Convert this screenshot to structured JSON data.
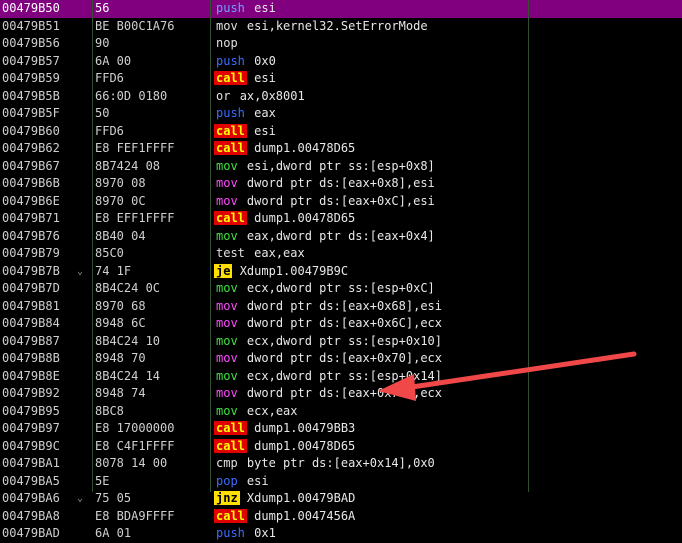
{
  "rows": [
    {
      "addr": "00479B50",
      "jmp": "",
      "hex": "56",
      "mn": "push",
      "ops": "esi",
      "cls": "m-push",
      "selected": true
    },
    {
      "addr": "00479B51",
      "jmp": "",
      "hex": "BE B00C1A76",
      "mn": "mov",
      "ops": "esi,kernel32.SetErrorMode",
      "cls": "m-nop"
    },
    {
      "addr": "00479B56",
      "jmp": "",
      "hex": "90",
      "mn": "nop",
      "ops": "",
      "cls": "m-nop"
    },
    {
      "addr": "00479B57",
      "jmp": "",
      "hex": "6A 00",
      "mn": "push",
      "ops": "0x0",
      "cls": "m-push"
    },
    {
      "addr": "00479B59",
      "jmp": "",
      "hex": "FFD6",
      "mn": "call",
      "ops": "esi",
      "cls": "m-call"
    },
    {
      "addr": "00479B5B",
      "jmp": "",
      "hex": "66:0D 0180",
      "mn": "or",
      "ops": "ax,0x8001",
      "cls": "m-or"
    },
    {
      "addr": "00479B5F",
      "jmp": "",
      "hex": "50",
      "mn": "push",
      "ops": "eax",
      "cls": "m-push"
    },
    {
      "addr": "00479B60",
      "jmp": "",
      "hex": "FFD6",
      "mn": "call",
      "ops": "esi",
      "cls": "m-call"
    },
    {
      "addr": "00479B62",
      "jmp": "",
      "hex": "E8 FEF1FFFF",
      "mn": "call",
      "ops": "dump1.00478D65",
      "cls": "m-call"
    },
    {
      "addr": "00479B67",
      "jmp": "",
      "hex": "8B7424 08",
      "mn": "mov",
      "ops": "esi,dword ptr ss:[esp+0x8]",
      "cls": "m-movreg"
    },
    {
      "addr": "00479B6B",
      "jmp": "",
      "hex": "8970 08",
      "mn": "mov",
      "ops": "dword ptr ds:[eax+0x8],esi",
      "cls": "m-mov"
    },
    {
      "addr": "00479B6E",
      "jmp": "",
      "hex": "8970 0C",
      "mn": "mov",
      "ops": "dword ptr ds:[eax+0xC],esi",
      "cls": "m-mov"
    },
    {
      "addr": "00479B71",
      "jmp": "",
      "hex": "E8 EFF1FFFF",
      "mn": "call",
      "ops": "dump1.00478D65",
      "cls": "m-call"
    },
    {
      "addr": "00479B76",
      "jmp": "",
      "hex": "8B40 04",
      "mn": "mov",
      "ops": "eax,dword ptr ds:[eax+0x4]",
      "cls": "m-movreg"
    },
    {
      "addr": "00479B79",
      "jmp": "",
      "hex": "85C0",
      "mn": "test",
      "ops": "eax,eax",
      "cls": "m-test"
    },
    {
      "addr": "00479B7B",
      "jmp": "⌄",
      "hex": "74 1F",
      "mn": "je",
      "ops": "Xdump1.00479B9C",
      "cls": "m-jcc"
    },
    {
      "addr": "00479B7D",
      "jmp": "",
      "hex": "8B4C24 0C",
      "mn": "mov",
      "ops": "ecx,dword ptr ss:[esp+0xC]",
      "cls": "m-movreg"
    },
    {
      "addr": "00479B81",
      "jmp": "",
      "hex": "8970 68",
      "mn": "mov",
      "ops": "dword ptr ds:[eax+0x68],esi",
      "cls": "m-mov"
    },
    {
      "addr": "00479B84",
      "jmp": "",
      "hex": "8948 6C",
      "mn": "mov",
      "ops": "dword ptr ds:[eax+0x6C],ecx",
      "cls": "m-mov"
    },
    {
      "addr": "00479B87",
      "jmp": "",
      "hex": "8B4C24 10",
      "mn": "mov",
      "ops": "ecx,dword ptr ss:[esp+0x10]",
      "cls": "m-movreg"
    },
    {
      "addr": "00479B8B",
      "jmp": "",
      "hex": "8948 70",
      "mn": "mov",
      "ops": "dword ptr ds:[eax+0x70],ecx",
      "cls": "m-mov"
    },
    {
      "addr": "00479B8E",
      "jmp": "",
      "hex": "8B4C24 14",
      "mn": "mov",
      "ops": "ecx,dword ptr ss:[esp+0x14]",
      "cls": "m-movreg"
    },
    {
      "addr": "00479B92",
      "jmp": "",
      "hex": "8948 74",
      "mn": "mov",
      "ops": "dword ptr ds:[eax+0x74],ecx",
      "cls": "m-mov"
    },
    {
      "addr": "00479B95",
      "jmp": "",
      "hex": "8BC8",
      "mn": "mov",
      "ops": "ecx,eax",
      "cls": "m-movreg"
    },
    {
      "addr": "00479B97",
      "jmp": "",
      "hex": "E8 17000000",
      "mn": "call",
      "ops": "dump1.00479BB3",
      "cls": "m-call"
    },
    {
      "addr": "00479B9C",
      "jmp": "",
      "hex": "E8 C4F1FFFF",
      "mn": "call",
      "ops": "dump1.00478D65",
      "cls": "m-call"
    },
    {
      "addr": "00479BA1",
      "jmp": "",
      "hex": "8078 14 00",
      "mn": "cmp",
      "ops": "byte ptr ds:[eax+0x14],0x0",
      "cls": "m-cmp"
    },
    {
      "addr": "00479BA5",
      "jmp": "",
      "hex": "5E",
      "mn": "pop",
      "ops": "esi",
      "cls": "m-pop"
    },
    {
      "addr": "00479BA6",
      "jmp": "⌄",
      "hex": "75 05",
      "mn": "jnz",
      "ops": "Xdump1.00479BAD",
      "cls": "m-jcc"
    },
    {
      "addr": "00479BA8",
      "jmp": "",
      "hex": "E8 BDA9FFFF",
      "mn": "call",
      "ops": "dump1.0047456A",
      "cls": "m-call"
    },
    {
      "addr": "00479BAD",
      "jmp": "",
      "hex": "6A 01",
      "mn": "push",
      "ops": "0x1",
      "cls": "m-push"
    }
  ],
  "colors": {
    "background": "#000000",
    "selected_row": "#800080",
    "call_bg": "#e00000",
    "call_fg": "#ffff00",
    "jcc_bg": "#ffe000",
    "annotation_arrow": "#f04848"
  }
}
